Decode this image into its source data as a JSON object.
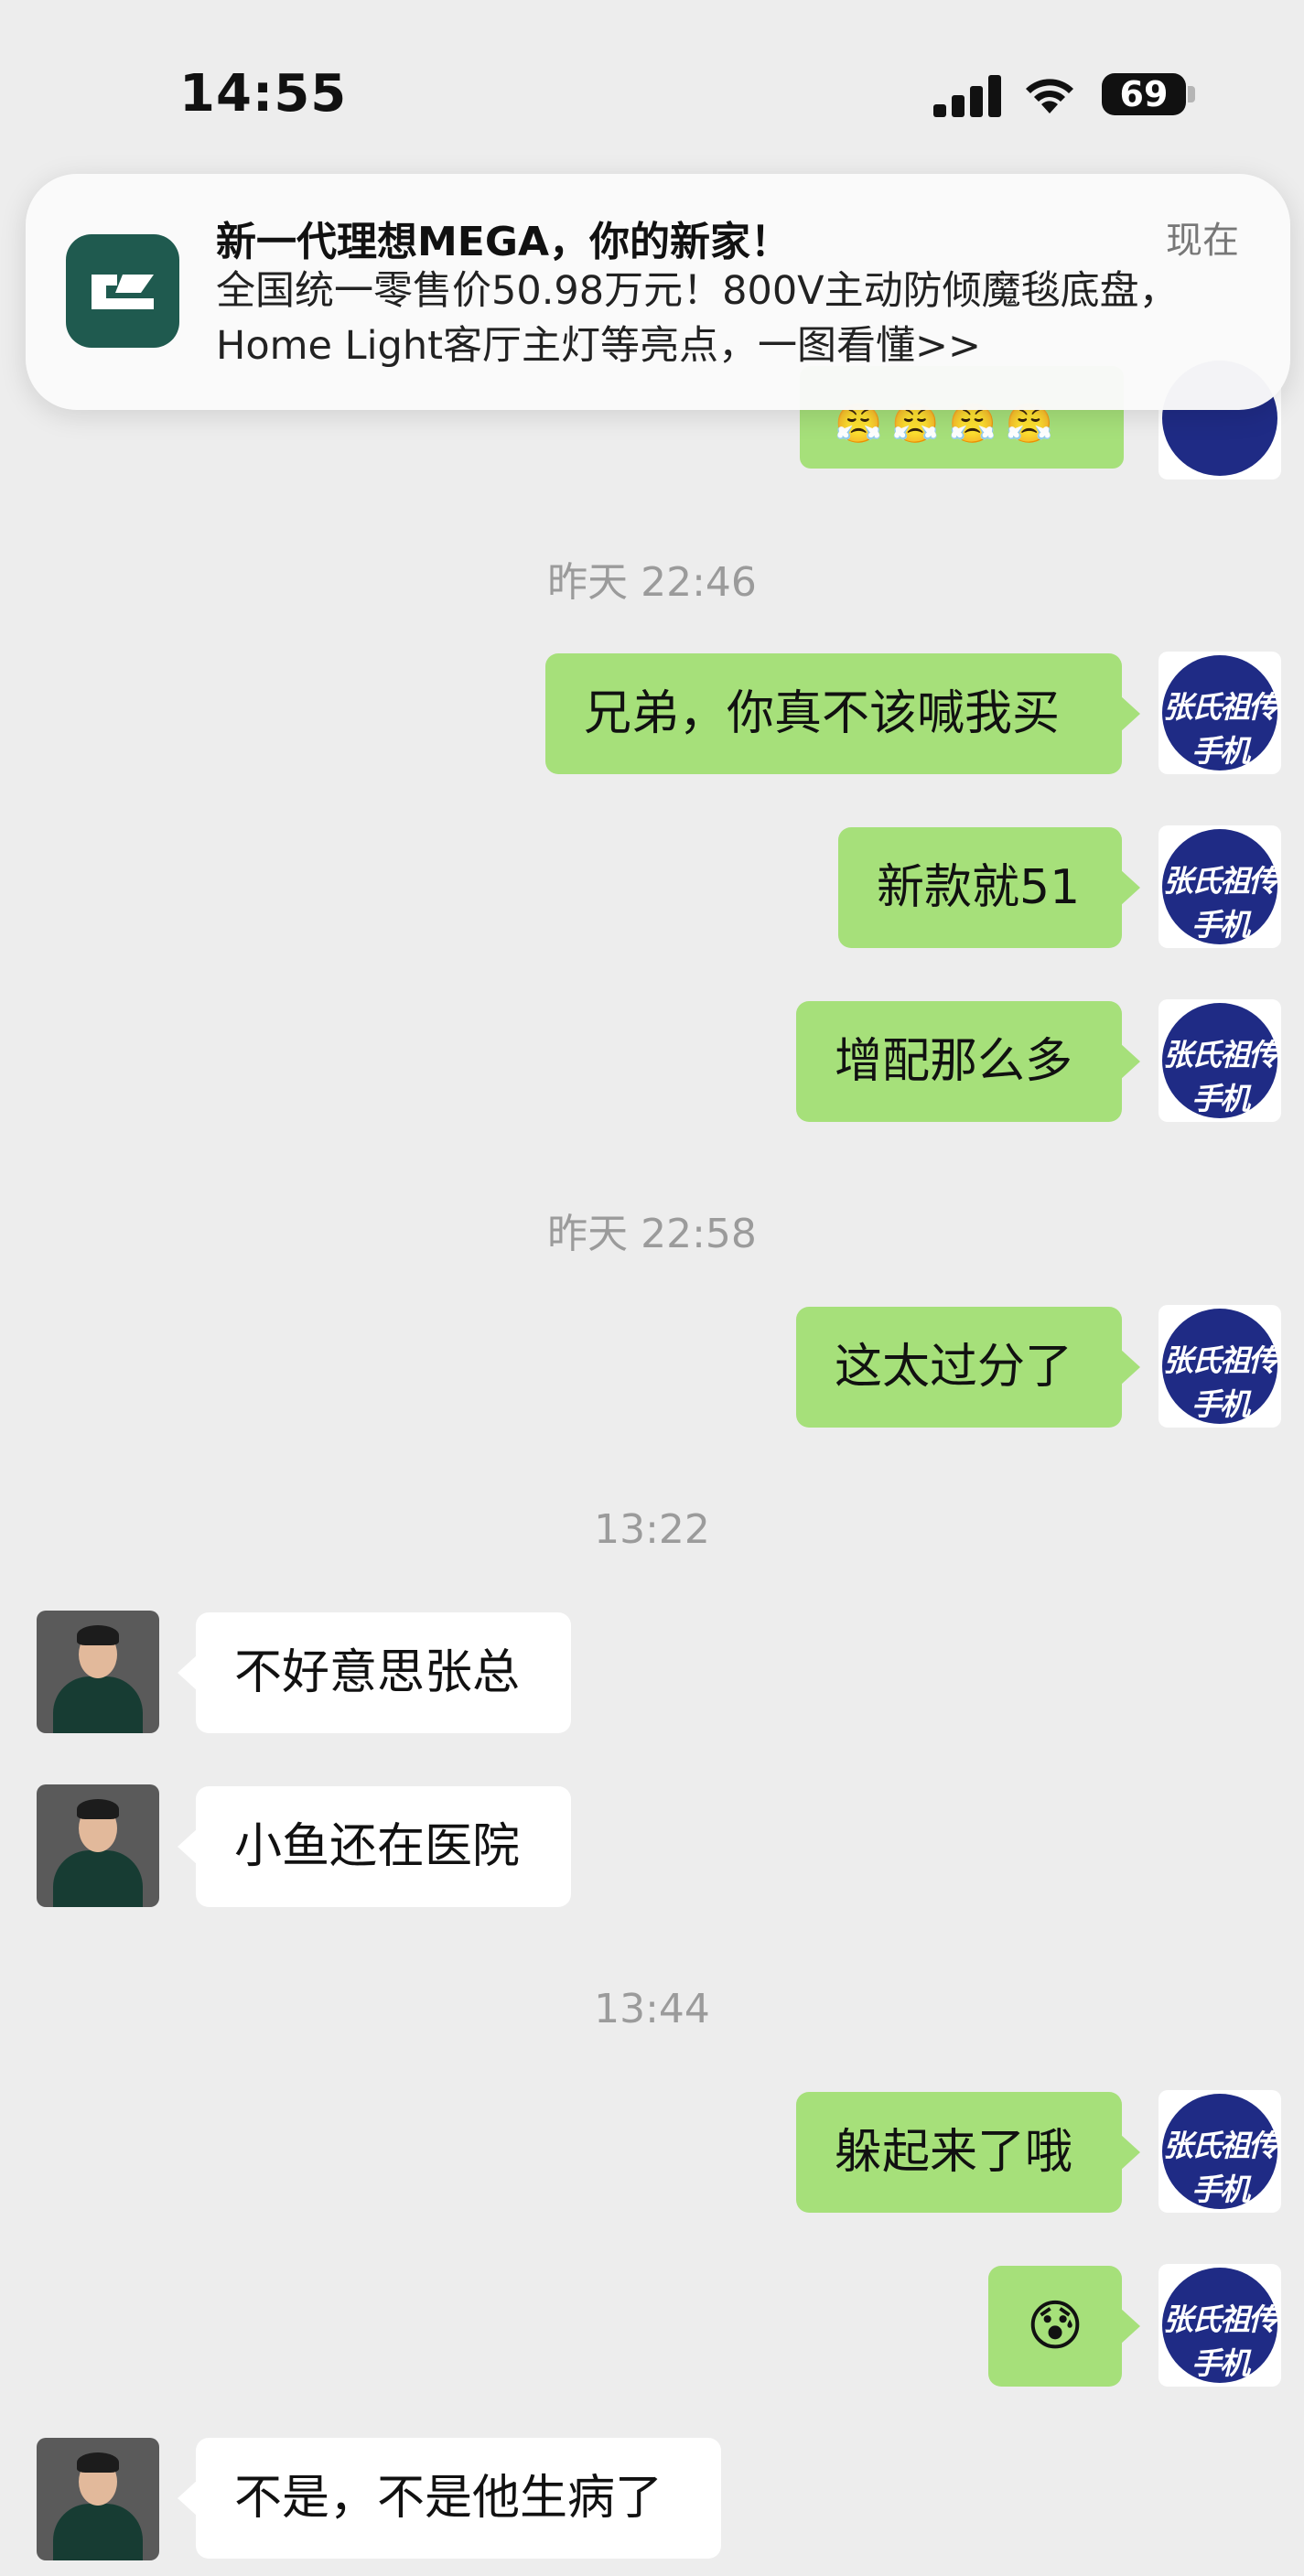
{
  "status_bar": {
    "time": "14:55",
    "battery": "69"
  },
  "notification": {
    "title": "新一代理想MEGA，你的新家！",
    "time": "现在",
    "body": "全国统一零售价50.98万元！800V主动防倾魔毯底盘，Home Light客厅主灯等亮点，一图看懂>>"
  },
  "peek_emojis": "😤😤😤😤",
  "me_avatar_logo": "张氏祖传手机",
  "messages": {
    "ts1": "昨天 22:46",
    "m1": "兄弟，你真不该喊我买",
    "m2": "新款就51",
    "m3": "增配那么多",
    "ts2": "昨天 22:58",
    "m4": "这太过分了",
    "ts3": "13:22",
    "m5": "不好意思张总",
    "m6": "小鱼还在医院",
    "ts4": "13:44",
    "m7": "躲起来了哦",
    "m8": "😰",
    "m9": "不是，不是他生病了"
  },
  "colors": {
    "my_bubble": "#a6e07a",
    "their_bubble": "#ffffff",
    "background": "#ededed",
    "app_icon": "#1f5a4f",
    "my_avatar": "#1f2b85"
  }
}
